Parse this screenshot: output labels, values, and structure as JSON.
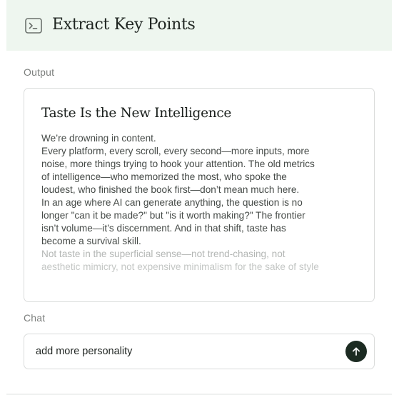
{
  "header": {
    "icon": "terminal-icon",
    "title": "Extract Key Points",
    "background": "#eef6ef"
  },
  "output": {
    "label": "Output",
    "title": "Taste Is the New Intelligence",
    "lines": [
      "We’re drowning in content.",
      "Every platform, every scroll, every second—more inputs, more",
      "noise, more things trying to hook your attention. The old metrics",
      "of intelligence—who memorized the most, who spoke the",
      "loudest, who finished the book first—don’t mean much here.",
      "In an age where AI can generate anything, the question is no",
      "longer \"can it be made?\" but \"is it worth making?\" The frontier",
      "isn’t volume—it’s discernment. And in that shift, taste has",
      "become a survival skill."
    ],
    "faded_lines": [
      "Not taste in the superficial sense—not trend-chasing, not",
      "aesthetic mimicry, not expensive minimalism for the sake of style"
    ]
  },
  "chat": {
    "label": "Chat",
    "value": "add more personality",
    "send_icon": "arrow-up-icon",
    "send_color": "#1c2b22"
  }
}
